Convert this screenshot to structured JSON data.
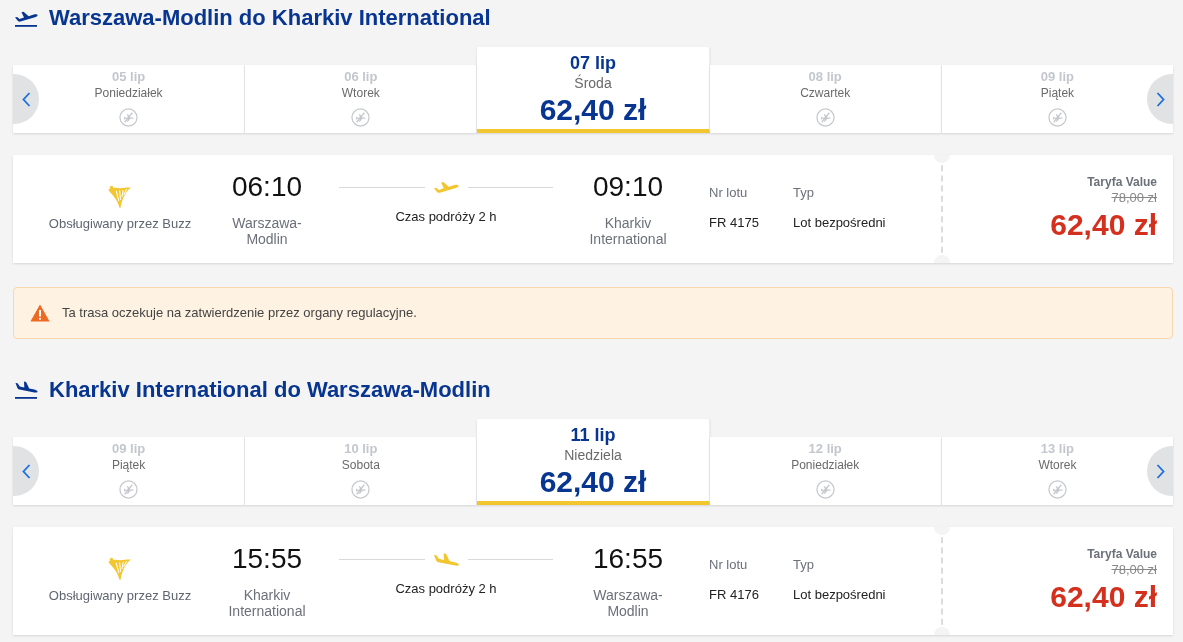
{
  "journeys": [
    {
      "kind": "outbound",
      "heading": "Warszawa-Modlin do Kharkiv International",
      "dates": [
        {
          "date": "05 lip",
          "day": "Poniedziałek",
          "selected": false
        },
        {
          "date": "06 lip",
          "day": "Wtorek",
          "selected": false
        },
        {
          "date": "07 lip",
          "day": "Środa",
          "price": "62,40 zł",
          "selected": true
        },
        {
          "date": "08 lip",
          "day": "Czwartek",
          "selected": false
        },
        {
          "date": "09 lip",
          "day": "Piątek",
          "selected": false
        }
      ],
      "flight": {
        "operator": "Obsługiwany przez Buzz",
        "departure_time": "06:10",
        "departure_airport": "Warszawa-Modlin",
        "duration": "Czas podróży 2 h",
        "arrival_time": "09:10",
        "arrival_airport": "Kharkiv International",
        "flight_number_label": "Nr lotu",
        "flight_number": "FR 4175",
        "type_label": "Typ",
        "type": "Lot bezpośredni",
        "fare_name": "Taryfa Value",
        "old_price": "78,00 zł",
        "price": "62,40 zł"
      },
      "notice": "Ta trasa oczekuje na zatwierdzenie przez organy regulacyjne."
    },
    {
      "kind": "inbound",
      "heading": "Kharkiv International do Warszawa-Modlin",
      "dates": [
        {
          "date": "09 lip",
          "day": "Piątek",
          "selected": false
        },
        {
          "date": "10 lip",
          "day": "Sobota",
          "selected": false
        },
        {
          "date": "11 lip",
          "day": "Niedziela",
          "price": "62,40 zł",
          "selected": true
        },
        {
          "date": "12 lip",
          "day": "Poniedziałek",
          "selected": false
        },
        {
          "date": "13 lip",
          "day": "Wtorek",
          "selected": false
        }
      ],
      "flight": {
        "operator": "Obsługiwany przez Buzz",
        "departure_time": "15:55",
        "departure_airport": "Kharkiv International",
        "duration": "Czas podróży 2 h",
        "arrival_time": "16:55",
        "arrival_airport": "Warszawa-Modlin",
        "flight_number_label": "Nr lotu",
        "flight_number": "FR 4176",
        "type_label": "Typ",
        "type": "Lot bezpośredni",
        "fare_name": "Taryfa Value",
        "old_price": "78,00 zł",
        "price": "62,40 zł"
      }
    }
  ]
}
